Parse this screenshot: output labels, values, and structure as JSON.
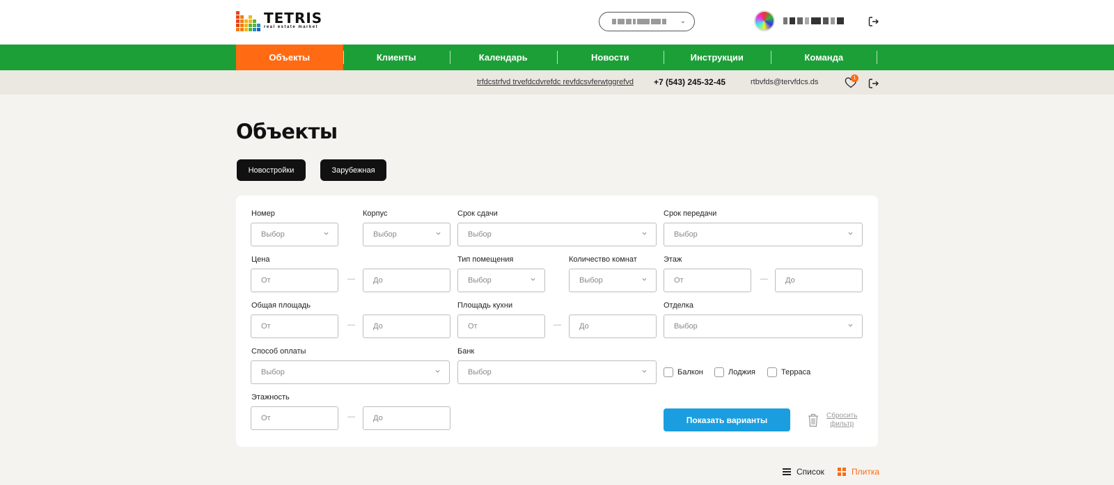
{
  "header": {
    "logo_title": "TETRIS",
    "logo_subtitle": "real estate market",
    "logo_colors": [
      "#e8431a",
      "#f07b16",
      "#f5b51a",
      "#5cb531",
      "#1f8ed0",
      "#2a5db0"
    ]
  },
  "nav": {
    "items": [
      {
        "label": "Объекты",
        "active": true
      },
      {
        "label": "Клиенты",
        "active": false
      },
      {
        "label": "Календарь",
        "active": false
      },
      {
        "label": "Новости",
        "active": false
      },
      {
        "label": "Инструкции",
        "active": false
      },
      {
        "label": "Команда",
        "active": false
      }
    ]
  },
  "contact": {
    "address": "trfdcstrfvd trvefdcdvrefdc revfdcsvferwtggrefvd",
    "phone": "+7 (543) 245-32-45",
    "email": "rtbvfds@tervfdcs.ds",
    "favorites_count": "1"
  },
  "page": {
    "title": "Объекты",
    "categories": [
      "Новостройки",
      "Зарубежная"
    ]
  },
  "filters": {
    "number": {
      "label": "Номер",
      "placeholder": "Выбор"
    },
    "building": {
      "label": "Корпус",
      "placeholder": "Выбор"
    },
    "deadline": {
      "label": "Срок сдачи",
      "placeholder": "Выбор"
    },
    "handover": {
      "label": "Срок передачи",
      "placeholder": "Выбор"
    },
    "price": {
      "label": "Цена",
      "from": "От",
      "to": "До"
    },
    "room_type": {
      "label": "Тип помещения",
      "placeholder": "Выбор"
    },
    "rooms": {
      "label": "Количество комнат",
      "placeholder": "Выбор"
    },
    "floor": {
      "label": "Этаж",
      "from": "От",
      "to": "До"
    },
    "total_area": {
      "label": "Общая площадь",
      "from": "От",
      "to": "До"
    },
    "kitchen_area": {
      "label": "Площадь кухни",
      "from": "От",
      "to": "До"
    },
    "finishing": {
      "label": "Отделка",
      "placeholder": "Выбор"
    },
    "payment": {
      "label": "Способ оплаты",
      "placeholder": "Выбор"
    },
    "bank": {
      "label": "Банк",
      "placeholder": "Выбор"
    },
    "floors": {
      "label": "Этажность",
      "from": "От",
      "to": "До"
    },
    "checkboxes": [
      "Балкон",
      "Лоджия",
      "Терраса"
    ],
    "dash": "—",
    "show_button": "Показать варианты",
    "reset_line1": "Сбросить",
    "reset_line2": "фильтр"
  },
  "view": {
    "list_label": "Список",
    "tile_label": "Плитка",
    "active": "tile",
    "accent_color": "#ff6a13"
  }
}
